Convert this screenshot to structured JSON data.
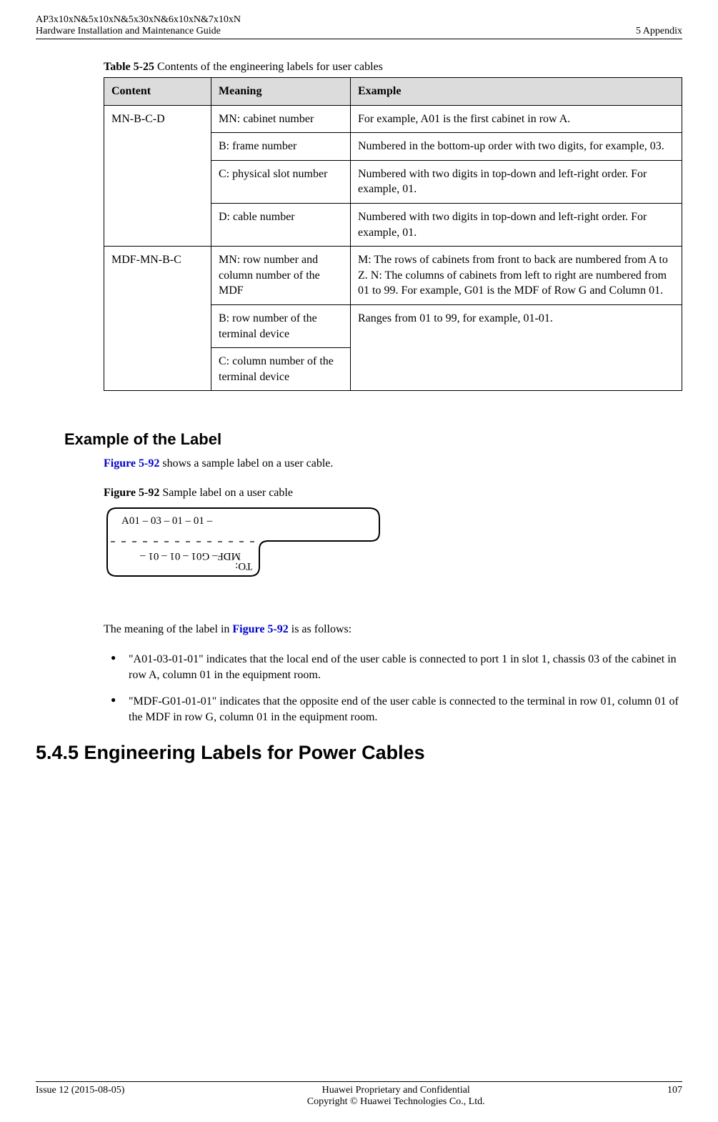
{
  "header": {
    "left_line1": "AP3x10xN&5x10xN&5x30xN&6x10xN&7x10xN",
    "left_line2": "Hardware Installation and Maintenance Guide",
    "right": "5 Appendix"
  },
  "table": {
    "caption_bold": "Table 5-25",
    "caption_rest": " Contents of the engineering labels for user cables",
    "headers": {
      "c1": "Content",
      "c2": "Meaning",
      "c3": "Example"
    },
    "rows": {
      "r1": {
        "content": "MN-B-C-D",
        "meaning": "MN: cabinet number",
        "example": "For example, A01 is the first cabinet in row A."
      },
      "r2": {
        "meaning": "B: frame number",
        "example": "Numbered in the bottom-up order with two digits, for example, 03."
      },
      "r3": {
        "meaning": "C: physical slot number",
        "example": "Numbered with two digits in top-down and left-right order. For example, 01."
      },
      "r4": {
        "meaning": "D: cable number",
        "example": "Numbered with two digits in top-down and left-right order. For example, 01."
      },
      "r5": {
        "content": "MDF-MN-B-C",
        "meaning": "MN: row number and column number of the MDF",
        "example": "M: The rows of cabinets from front to back are numbered from A to Z. N: The columns of cabinets from left to right are numbered from 01 to 99. For example, G01 is the MDF of Row G and Column 01."
      },
      "r6": {
        "meaning": "B: row number of the terminal device",
        "example": "Ranges from 01 to 99, for example, 01-01."
      },
      "r7": {
        "meaning": "C: column number of the terminal device"
      }
    }
  },
  "section": {
    "heading": "Example of the Label",
    "intro_pre": " shows a sample label on a user cable.",
    "fig_ref": "Figure 5-92",
    "fig_caption_bold": "Figure 5-92",
    "fig_caption_rest": " Sample label on a user cable",
    "label_top": "A01 – 03  – 01 – 01 –",
    "label_bottom": "MDF– G01 – 01 – 01  –",
    "label_to": "TO:",
    "meaning_intro_pre": "The meaning of the label in ",
    "meaning_intro_post": " is as follows:",
    "bullets": {
      "b1": "\"A01-03-01-01\" indicates that the local end of the user cable is connected to port 1 in slot 1, chassis 03 of the cabinet in row A, column 01 in the equipment room.",
      "b2": "\"MDF-G01-01-01\" indicates that the opposite end of the user cable is connected to the terminal in row 01, column 01 of the MDF in row G, column 01 in the equipment room."
    }
  },
  "h2": "5.4.5 Engineering Labels for Power Cables",
  "footer": {
    "left": "Issue 12 (2015-08-05)",
    "center_line1": "Huawei Proprietary and Confidential",
    "center_line2": "Copyright © Huawei Technologies Co., Ltd.",
    "right": "107"
  }
}
